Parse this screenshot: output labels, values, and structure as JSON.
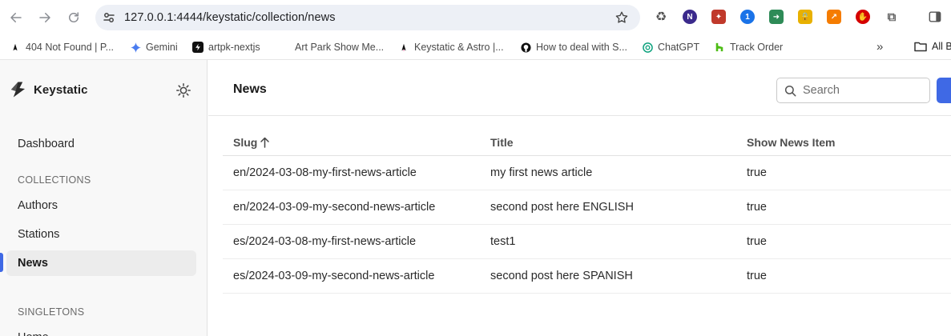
{
  "browser": {
    "url": "127.0.0.1:4444/keystatic/collection/news",
    "bookmarks": [
      {
        "label": "404 Not Found | P...",
        "icon": "astro-icon"
      },
      {
        "label": "Gemini",
        "icon": "gemini-icon"
      },
      {
        "label": "artpk-nextjs",
        "icon": "vercel-icon"
      },
      {
        "label": "Art Park Show Me...",
        "icon": "blank-icon"
      },
      {
        "label": "Keystatic & Astro |...",
        "icon": "astro-icon"
      },
      {
        "label": "How to deal with S...",
        "icon": "github-icon"
      },
      {
        "label": "ChatGPT",
        "icon": "chatgpt-icon"
      },
      {
        "label": "Track Order",
        "icon": "houzz-icon"
      }
    ],
    "more_label": "»",
    "all_bookmarks_label": "All B"
  },
  "sidebar": {
    "brand": "Keystatic",
    "dashboard_label": "Dashboard",
    "collections_heading": "COLLECTIONS",
    "collections": [
      {
        "label": "Authors"
      },
      {
        "label": "Stations"
      },
      {
        "label": "News",
        "active": true
      }
    ],
    "singletons_heading": "SINGLETONS",
    "singletons": [
      {
        "label": "Home"
      }
    ]
  },
  "main": {
    "title": "News",
    "search_placeholder": "Search",
    "table": {
      "headers": [
        "Slug",
        "Title",
        "Show News Item"
      ],
      "rows": [
        [
          "en/2024-03-08-my-first-news-article",
          "my first news article",
          "true"
        ],
        [
          "en/2024-03-09-my-second-news-article",
          "second post here ENGLISH",
          "true"
        ],
        [
          "es/2024-03-08-my-first-news-article",
          "test1",
          "true"
        ],
        [
          "es/2024-03-09-my-second-news-article",
          "second post here SPANISH",
          "true"
        ]
      ]
    }
  },
  "colors": {
    "accent": "#3f69e5",
    "active_nav_bg": "#ececec",
    "sidebar_bg": "#f8f8f8",
    "omnibox_bg": "#edf0f6"
  }
}
